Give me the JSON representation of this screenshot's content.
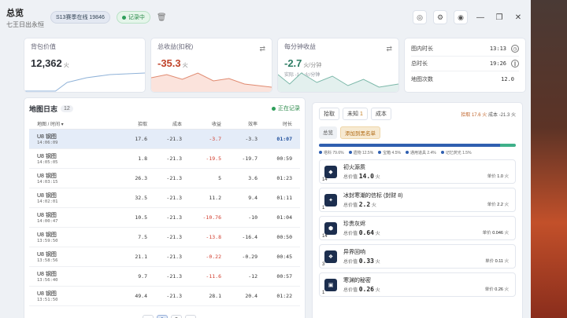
{
  "header": {
    "title": "总览",
    "subtitle": "七王日出永恒",
    "season": "S13赛季在线 19846",
    "recording": "记录中"
  },
  "stats": {
    "total_value": {
      "label": "背包价值",
      "value": "12,362",
      "unit": "火"
    },
    "total_gain": {
      "label": "总收益(扣税)",
      "value": "-35.3",
      "unit": "火"
    },
    "per_min": {
      "label": "每分钟收益",
      "value": "-2.7",
      "unit": "火/分钟",
      "sub": "实际 -1.8 火/分钟"
    },
    "side": [
      {
        "label": "图内时长",
        "value": "13:13",
        "icon": "clock-icon"
      },
      {
        "label": "总时长",
        "value": "19:26",
        "icon": "pause-icon"
      },
      {
        "label": "地图次数",
        "value": "12.0",
        "icon": ""
      }
    ]
  },
  "log": {
    "title": "地图日志",
    "count": "12",
    "recording": "正在记录",
    "columns": [
      "地图 / 时间",
      "拾取",
      "成本",
      "收益",
      "效率",
      "时长"
    ],
    "rows": [
      {
        "map": "U8 钢图",
        "time": "14:06:09",
        "pick": "17.6",
        "cost": "-21.3",
        "gain": "-3.7",
        "eff": "-3.3",
        "dur": "01:07",
        "active": true
      },
      {
        "map": "U8 钢图",
        "time": "14:05:05",
        "pick": "1.8",
        "cost": "-21.3",
        "gain": "-19.5",
        "eff": "-19.7",
        "dur": "00:59",
        "active": false
      },
      {
        "map": "U8 钢图",
        "time": "14:03:15",
        "pick": "26.3",
        "cost": "-21.3",
        "gain": "5",
        "eff": "3.6",
        "dur": "01:23",
        "active": false
      },
      {
        "map": "U8 钢图",
        "time": "14:02:01",
        "pick": "32.5",
        "cost": "-21.3",
        "gain": "11.2",
        "eff": "9.4",
        "dur": "01:11",
        "active": false
      },
      {
        "map": "U8 钢图",
        "time": "14:00:47",
        "pick": "10.5",
        "cost": "-21.3",
        "gain": "-10.76",
        "eff": "-10",
        "dur": "01:04",
        "active": false
      },
      {
        "map": "U8 钢图",
        "time": "13:59:50",
        "pick": "7.5",
        "cost": "-21.3",
        "gain": "-13.8",
        "eff": "-16.4",
        "dur": "00:50",
        "active": false
      },
      {
        "map": "U8 钢图",
        "time": "13:58:56",
        "pick": "21.1",
        "cost": "-21.3",
        "gain": "-0.22",
        "eff": "-0.29",
        "dur": "00:45",
        "active": false
      },
      {
        "map": "U8 钢图",
        "time": "13:56:40",
        "pick": "9.7",
        "cost": "-21.3",
        "gain": "-11.6",
        "eff": "-12",
        "dur": "00:57",
        "active": false
      },
      {
        "map": "U8 钢图",
        "time": "13:51:50",
        "pick": "49.4",
        "cost": "-21.3",
        "gain": "28.1",
        "eff": "20.4",
        "dur": "01:22",
        "active": false
      }
    ],
    "pages": [
      "1",
      "2"
    ]
  },
  "drops": {
    "tabs": [
      {
        "label": "拾取",
        "badge": ""
      },
      {
        "label": "未知",
        "badge": "1"
      },
      {
        "label": "成本",
        "badge": ""
      }
    ],
    "totals_pick": "拾取 17.6 火",
    "totals_cost": "成本 -21.3 火",
    "filters": [
      "总览",
      "添加到黑名单"
    ],
    "legend": [
      "塔科 79.6%",
      "遗物 12.5%",
      "宝箱 4.5%",
      "通用道具 2.4%",
      "记忆荧光 1.5%"
    ],
    "items": [
      {
        "qty": "14",
        "name": "初火源质",
        "total_label": "总价值",
        "total": "14.0",
        "unit_price": "1.0",
        "unit_label": "单价"
      },
      {
        "qty": "1",
        "name": "冰封寒潮的信标 (封财 8)",
        "total_label": "总价值",
        "total": "2.2",
        "unit_price": "2.2",
        "unit_label": "单价"
      },
      {
        "qty": "14",
        "name": "珍贵灰烬",
        "total_label": "总价值",
        "total": "0.64",
        "unit_price": "0.046",
        "unit_label": "单价"
      },
      {
        "qty": "3",
        "name": "异界回响",
        "total_label": "总价值",
        "total": "0.33",
        "unit_price": "0.11",
        "unit_label": "单价"
      },
      {
        "qty": "1",
        "name": "寒渊的秘密",
        "total_label": "总价值",
        "total": "0.26",
        "unit_price": "0.26",
        "unit_label": "单价"
      }
    ],
    "currency": "火"
  }
}
